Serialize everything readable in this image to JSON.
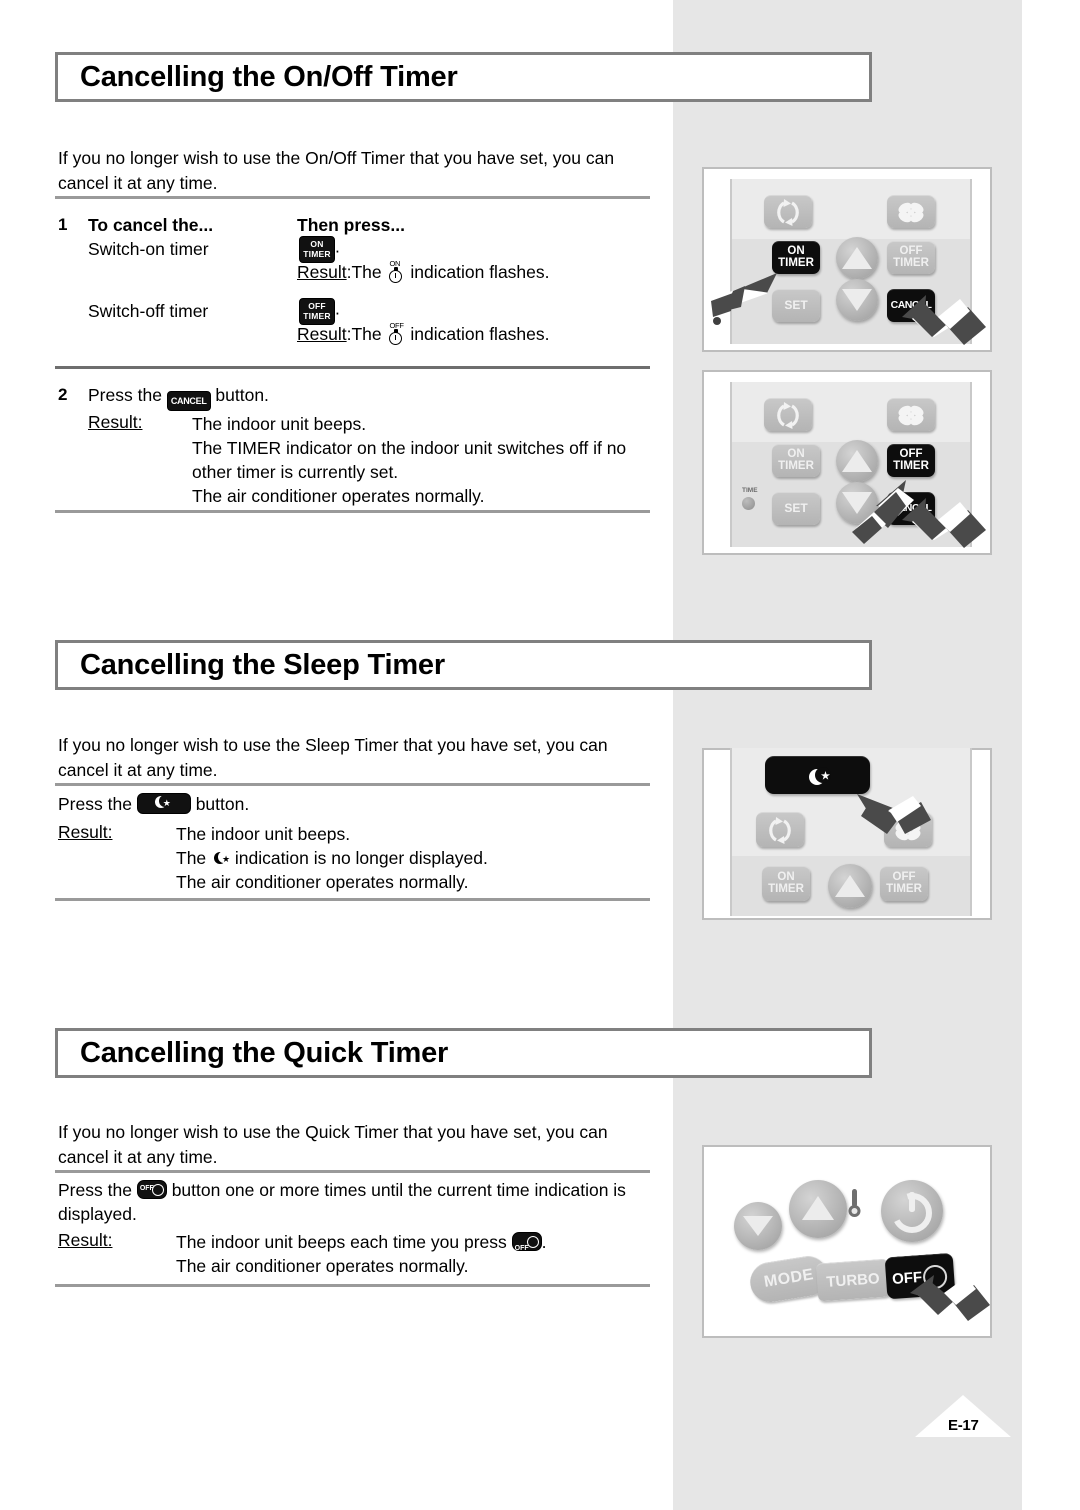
{
  "page": {
    "footer_label": "E-17",
    "background_color": "#ffffff",
    "band_color": "#e6e6e6"
  },
  "sections": [
    {
      "id": "onoff",
      "heading": "Cancelling the On/Off Timer",
      "intro": "If you no longer wish to use the On/Off Timer that you have set, you can cancel it at any time.",
      "step1": {
        "number": "1",
        "col1_header": "To cancel the...",
        "col2_header": "Then press...",
        "rows": [
          {
            "label": "Switch-on timer",
            "button": {
              "line1": "ON",
              "line2": "TIMER"
            },
            "result_prefix": "Result",
            "result_mid": ":The",
            "indicator_sup": "ON",
            "result_suffix": "indication flashes."
          },
          {
            "label": "Switch-off timer",
            "button": {
              "line1": "OFF",
              "line2": "TIMER"
            },
            "result_prefix": "Result",
            "result_mid": ":The",
            "indicator_sup": "OFF",
            "result_suffix": "indication flashes."
          }
        ]
      },
      "step2": {
        "number": "2",
        "text_before": "Press the",
        "button_label": "CANCEL",
        "text_after": "button.",
        "result_prefix": "Result:",
        "result_lines": [
          "The indoor unit beeps.",
          "The TIMER indicator on the indoor unit switches off if no",
          "other timer is currently set.",
          "The air conditioner operates normally."
        ]
      }
    },
    {
      "id": "sleep",
      "heading": "Cancelling the Sleep Timer",
      "intro": "If you no longer wish to use the Sleep Timer that you have set, you can cancel it at any time.",
      "press_before": "Press the",
      "press_button_icon": "sleep-moon-icon",
      "press_after": "button.",
      "result_prefix": "Result:",
      "result_line1": "The indoor unit beeps.",
      "result_line2_before": "The",
      "result_line2_icon": "sleep-moon-icon",
      "result_line2_after": "indication is no longer displayed.",
      "result_line3": "The air conditioner operates normally."
    },
    {
      "id": "quick",
      "heading": "Cancelling the Quick Timer",
      "intro": "If you no longer wish to use the Quick Timer that you have set, you can cancel it at any time.",
      "press_before": "Press the",
      "press_button_icon": "off-timer-badge-icon",
      "press_after": "button one or more times until the current time indication is",
      "press_after2": "displayed.",
      "result_prefix": "Result:",
      "result_line1_before": "The indoor unit beeps each time you press",
      "result_line1_after": ".",
      "result_line2": "The air conditioner operates normally."
    }
  ],
  "illustrations": [
    {
      "id": "remote-on-timer",
      "keys": [
        {
          "name": "swing-key",
          "label": "",
          "icon": "swing-icon",
          "lit": false
        },
        {
          "name": "fan-key",
          "label": "",
          "icon": "fan-icon",
          "lit": false
        },
        {
          "name": "on-timer-key",
          "line1": "ON",
          "line2": "TIMER",
          "lit": true
        },
        {
          "name": "off-timer-key",
          "line1": "OFF",
          "line2": "TIMER",
          "lit": false
        },
        {
          "name": "set-key",
          "line1": "SET",
          "lit": false
        },
        {
          "name": "cancel-key",
          "line1": "CANCEL",
          "lit": true
        },
        {
          "name": "up-key",
          "icon": "triangle-up-icon",
          "lit": false
        },
        {
          "name": "down-key",
          "icon": "triangle-down-icon",
          "lit": false
        }
      ],
      "pointers": [
        "on-timer-key",
        "cancel-key"
      ]
    },
    {
      "id": "remote-off-timer",
      "time_led_label": "TIME",
      "keys": [
        {
          "name": "swing-key",
          "icon": "swing-icon",
          "lit": false
        },
        {
          "name": "fan-key",
          "icon": "fan-icon",
          "lit": false
        },
        {
          "name": "on-timer-key",
          "line1": "ON",
          "line2": "TIMER",
          "lit": false
        },
        {
          "name": "off-timer-key",
          "line1": "OFF",
          "line2": "TIMER",
          "lit": true
        },
        {
          "name": "set-key",
          "line1": "SET",
          "lit": false
        },
        {
          "name": "cancel-key",
          "line1": "CANCEL",
          "lit": true
        },
        {
          "name": "up-key",
          "icon": "triangle-up-icon",
          "lit": false
        },
        {
          "name": "down-key",
          "icon": "triangle-down-icon",
          "lit": false
        }
      ],
      "pointers": [
        "off-timer-key",
        "cancel-key"
      ]
    },
    {
      "id": "remote-sleep",
      "keys": [
        {
          "name": "sleep-key",
          "icon": "moon-star-icon",
          "lit": true
        },
        {
          "name": "swing-key",
          "icon": "swing-icon",
          "lit": false
        },
        {
          "name": "fan-key",
          "icon": "fan-icon",
          "lit": false
        },
        {
          "name": "on-timer-key",
          "line1": "ON",
          "line2": "TIMER",
          "lit": false
        },
        {
          "name": "off-timer-key",
          "line1": "OFF",
          "line2": "TIMER",
          "lit": false
        },
        {
          "name": "up-key",
          "icon": "triangle-up-icon",
          "lit": false
        }
      ],
      "pointers": [
        "sleep-key"
      ]
    },
    {
      "id": "remote-quick",
      "keys": [
        {
          "name": "temp-down-key",
          "icon": "triangle-down-icon",
          "lit": false
        },
        {
          "name": "temp-up-key",
          "icon": "triangle-up-icon",
          "lit": false
        },
        {
          "name": "thermometer-icon",
          "icon": "thermometer-icon",
          "lit": false
        },
        {
          "name": "power-key",
          "icon": "power-icon",
          "lit": false
        },
        {
          "name": "mode-key",
          "line1": "MODE",
          "lit": false
        },
        {
          "name": "turbo-key",
          "line1": "TURBO",
          "lit": false
        },
        {
          "name": "off-timer-key",
          "line1": "OFF",
          "icon": "clock-icon",
          "lit": true
        }
      ],
      "pointers": [
        "off-timer-key"
      ]
    }
  ]
}
